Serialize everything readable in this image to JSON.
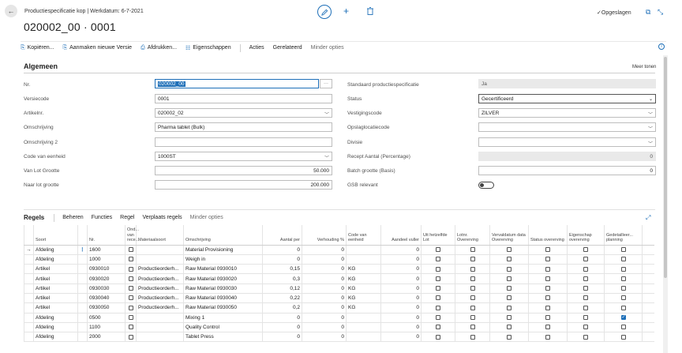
{
  "header": {
    "subtitle": "Productiespecificatie kop | Werkdatum: 6-7-2021",
    "title": "020002_00 · 0001",
    "saved_label": "Opgeslagen"
  },
  "actions": [
    {
      "label": "Kopiëren...",
      "icon": "copy-icon"
    },
    {
      "label": "Aanmaken nieuwe Versie",
      "icon": "new-version-icon"
    },
    {
      "label": "Afdrukken...",
      "icon": "print-icon"
    },
    {
      "label": "Eigenschappen",
      "icon": "properties-icon"
    },
    {
      "label": "Acties"
    },
    {
      "label": "Gerelateerd"
    },
    {
      "label": "Minder opties"
    }
  ],
  "general": {
    "title": "Algemeen",
    "more_label": "Meer tonen",
    "left": [
      {
        "label": "Nr.",
        "value": "020002_00"
      },
      {
        "label": "Versiecode",
        "value": "0001"
      },
      {
        "label": "Artikelnr.",
        "value": "020002_02"
      },
      {
        "label": "Omschrijving",
        "value": "Pharma tablet (Bulk)"
      },
      {
        "label": "Omschrijving 2",
        "value": ""
      },
      {
        "label": "Code van eenheid",
        "value": "1000ST"
      },
      {
        "label": "Van Lot Grootte",
        "value": "50.000"
      },
      {
        "label": "Naar lot grootte",
        "value": "200.000"
      }
    ],
    "right": [
      {
        "label": "Standaard productiespecificatie",
        "value": "Ja"
      },
      {
        "label": "Status",
        "value": "Gecertificeerd"
      },
      {
        "label": "Vestigingscode",
        "value": "ZILVER"
      },
      {
        "label": "Opslaglocatiecode",
        "value": ""
      },
      {
        "label": "Divisie",
        "value": ""
      },
      {
        "label": "Recept Aantal (Percentage)",
        "value": "0"
      },
      {
        "label": "Batch grootte (Basis)",
        "value": "0"
      },
      {
        "label": "GSB relevant",
        "value": ""
      }
    ]
  },
  "lines": {
    "title": "Regels",
    "menu": [
      "Beheren",
      "Functies",
      "Regel",
      "Verplaats regels",
      "Minder opties"
    ],
    "columns": [
      "Soort",
      "Nr.",
      "Ond... van rece...",
      "Materiaalsoort",
      "Omschrijving",
      "Aantal per",
      "Verhouding %",
      "Code van eenheid",
      "Aandeel vuller",
      "Uit hetzelfde Lot",
      "Lotnr. Overerving",
      "Vervaldatum data Overerving",
      "Status overerving",
      "Eigenschap overerving",
      "Gedetailleer... planning"
    ],
    "rows": [
      {
        "soort": "Afdeling",
        "nr": "1600",
        "mat": "",
        "omschr": "Material Provisioning",
        "aantal": "0",
        "verh": "0",
        "code": "",
        "aandeel": "0",
        "planning": false
      },
      {
        "soort": "Afdeling",
        "nr": "1000",
        "mat": "",
        "omschr": "Weigh in",
        "aantal": "0",
        "verh": "0",
        "code": "",
        "aandeel": "0",
        "planning": false
      },
      {
        "soort": "Artikel",
        "nr": "0930010",
        "mat": "Productieorderh...",
        "omschr": "Raw Material 0930010",
        "aantal": "0,15",
        "verh": "0",
        "code": "KG",
        "aandeel": "0",
        "planning": false
      },
      {
        "soort": "Artikel",
        "nr": "0930020",
        "mat": "Productieorderh...",
        "omschr": "Raw Material 0930020",
        "aantal": "0,3",
        "verh": "0",
        "code": "KG",
        "aandeel": "0",
        "planning": false
      },
      {
        "soort": "Artikel",
        "nr": "0930030",
        "mat": "Productieorderh...",
        "omschr": "Raw Material 0930030",
        "aantal": "0,12",
        "verh": "0",
        "code": "KG",
        "aandeel": "0",
        "planning": false
      },
      {
        "soort": "Artikel",
        "nr": "0930040",
        "mat": "Productieorderh...",
        "omschr": "Raw Material 0930040",
        "aantal": "0,22",
        "verh": "0",
        "code": "KG",
        "aandeel": "0",
        "planning": false
      },
      {
        "soort": "Artikel",
        "nr": "0930050",
        "mat": "Productieorderh...",
        "omschr": "Raw Material 0930050",
        "aantal": "0,2",
        "verh": "0",
        "code": "KG",
        "aandeel": "0",
        "planning": false
      },
      {
        "soort": "Afdeling",
        "nr": "0500",
        "mat": "",
        "omschr": "Mixing 1",
        "aantal": "0",
        "verh": "0",
        "code": "",
        "aandeel": "0",
        "planning": true
      },
      {
        "soort": "Afdeling",
        "nr": "1100",
        "mat": "",
        "omschr": "Quality Control",
        "aantal": "0",
        "verh": "0",
        "code": "",
        "aandeel": "0",
        "planning": false
      },
      {
        "soort": "Afdeling",
        "nr": "2000",
        "mat": "",
        "omschr": "Tablet Press",
        "aantal": "0",
        "verh": "0",
        "code": "",
        "aandeel": "0",
        "planning": false
      }
    ]
  },
  "colors": {
    "accent": "#1e6fb8"
  }
}
